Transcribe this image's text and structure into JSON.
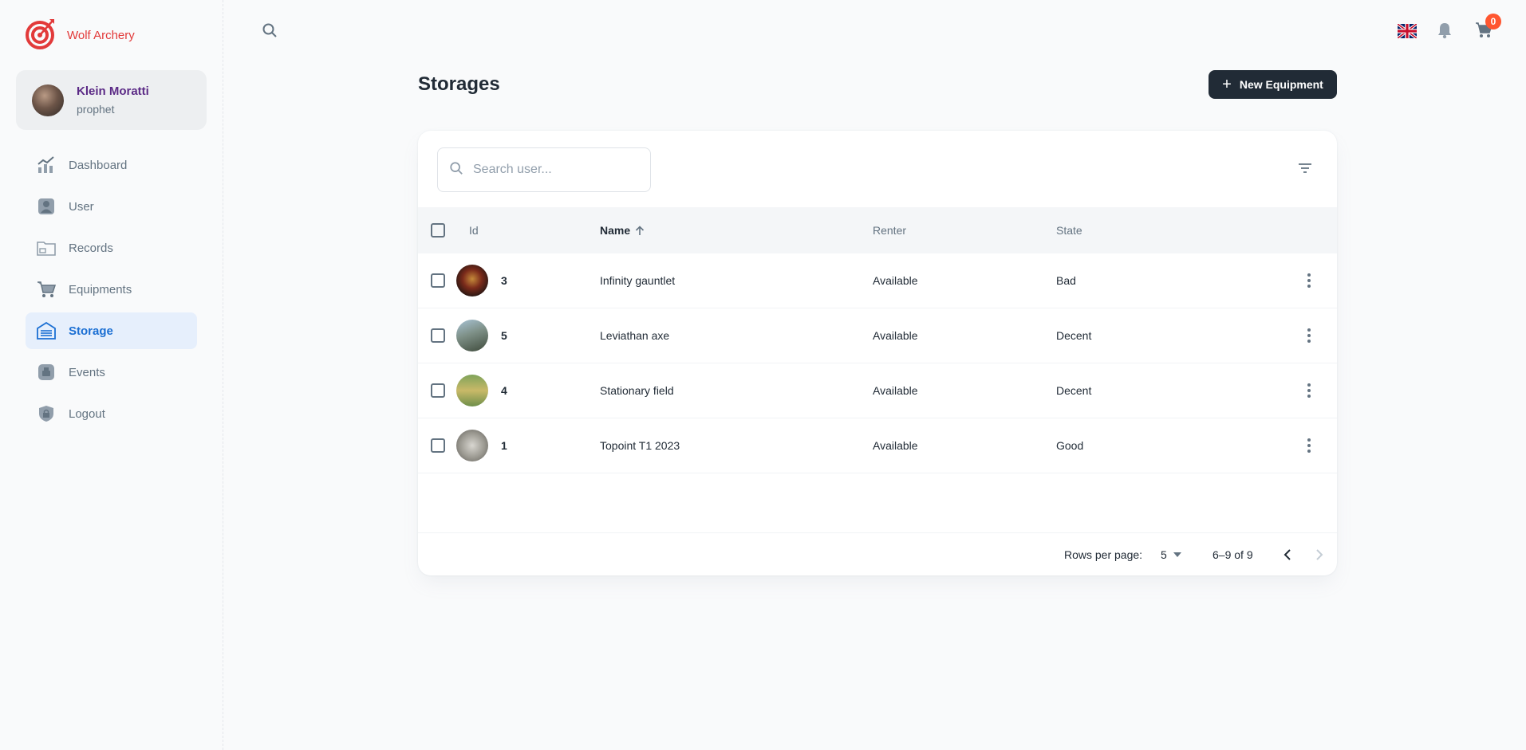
{
  "app": {
    "brand": "Wolf Archery"
  },
  "account": {
    "name": "Klein Moratti",
    "role": "prophet"
  },
  "nav": [
    {
      "label": "Dashboard",
      "icon": "dashboard-icon",
      "active": false
    },
    {
      "label": "User",
      "icon": "user-icon",
      "active": false
    },
    {
      "label": "Records",
      "icon": "records-icon",
      "active": false
    },
    {
      "label": "Equipments",
      "icon": "cart-icon",
      "active": false
    },
    {
      "label": "Storage",
      "icon": "storage-icon",
      "active": true
    },
    {
      "label": "Events",
      "icon": "events-icon",
      "active": false
    },
    {
      "label": "Logout",
      "icon": "lock-icon",
      "active": false
    }
  ],
  "header": {
    "cart_count": "0",
    "language": "en-GB"
  },
  "page": {
    "title": "Storages",
    "new_button": "New Equipment"
  },
  "table": {
    "search_placeholder": "Search user...",
    "columns": {
      "id": "Id",
      "name": "Name",
      "renter": "Renter",
      "state": "State"
    },
    "sort": {
      "column": "Name",
      "direction": "asc"
    },
    "rows": [
      {
        "id": "3",
        "name": "Infinity gauntlet",
        "renter": "Available",
        "state": "Bad"
      },
      {
        "id": "5",
        "name": "Leviathan axe",
        "renter": "Available",
        "state": "Decent"
      },
      {
        "id": "4",
        "name": "Stationary field",
        "renter": "Available",
        "state": "Decent"
      },
      {
        "id": "1",
        "name": "Topoint T1 2023",
        "renter": "Available",
        "state": "Good"
      }
    ],
    "pagination": {
      "rows_per_page_label": "Rows per page:",
      "rows_per_page": "5",
      "range": "6–9 of 9"
    }
  },
  "colors": {
    "accent": "#1b6fd3",
    "brand": "#e23a3a",
    "dark_button": "#212b36",
    "badge": "#ff5630"
  }
}
